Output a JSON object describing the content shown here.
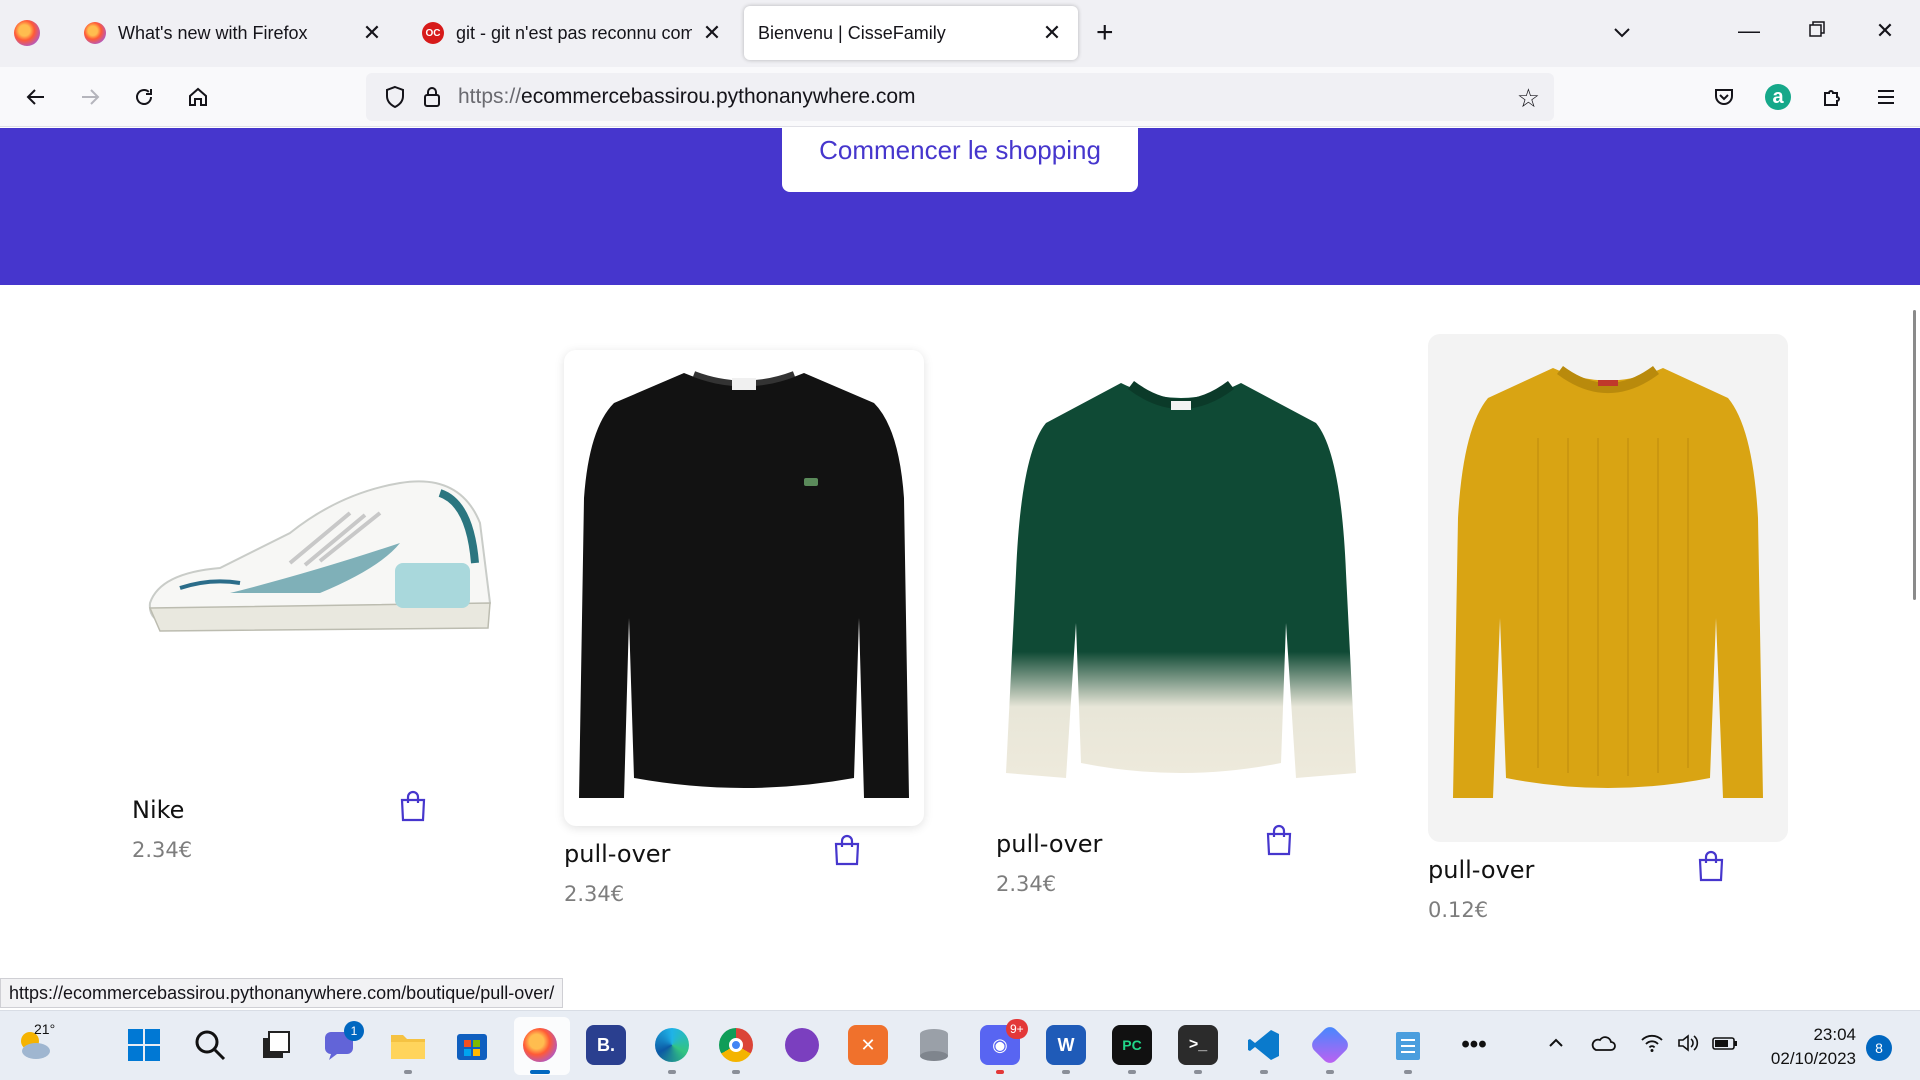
{
  "browser": {
    "tabs": [
      {
        "title": "What's new with Firefox",
        "favicon": "firefox-icon"
      },
      {
        "title": "git - git n'est pas reconnu comme commande",
        "favicon": "openclassrooms-icon"
      },
      {
        "title": "Bienvenu | CisseFamily",
        "favicon": "none",
        "active": true
      }
    ],
    "url_proto": "https://",
    "url_host": "ecommercebassirou.pythonanywhere.com",
    "status_url": "https://ecommercebassirou.pythonanywhere.com/boutique/pull-over/"
  },
  "page": {
    "hero_button": "Commencer le shopping",
    "hero_color": "#4636cd",
    "products": [
      {
        "name": "Nike",
        "price": "2.34€",
        "image": "sneaker-image"
      },
      {
        "name": "pull-over",
        "price": "2.34€",
        "image": "black-sweater-image"
      },
      {
        "name": "pull-over",
        "price": "2.34€",
        "image": "green-sweater-image"
      },
      {
        "name": "pull-over",
        "price": "0.12€",
        "image": "yellow-sweater-image"
      }
    ]
  },
  "taskbar": {
    "temperature": "21°",
    "teams_badge": "1",
    "discord_badge": "9+",
    "time": "23:04",
    "date": "02/10/2023",
    "notifications": "8"
  }
}
